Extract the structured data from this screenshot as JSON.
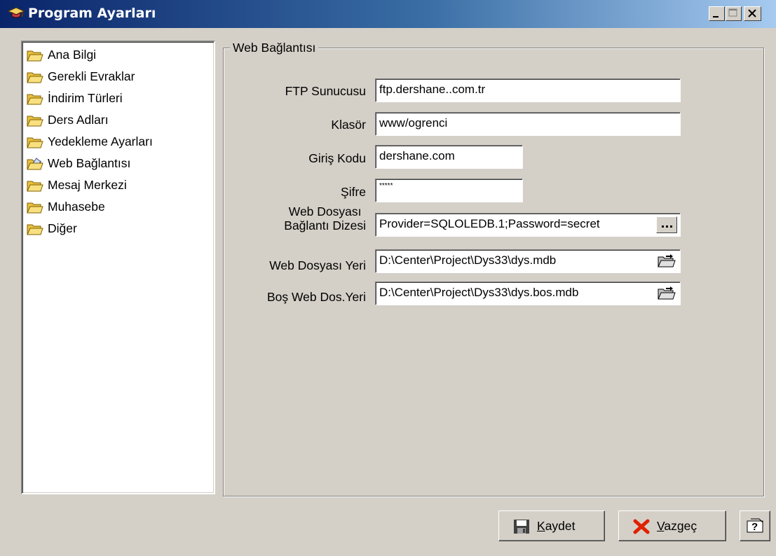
{
  "window": {
    "title": "Program Ayarları",
    "icon": "graduation-cap-icon",
    "controls": [
      "minimize",
      "maximize",
      "close"
    ]
  },
  "tree": {
    "items": [
      {
        "label": "Ana Bilgi",
        "icon": "folder-icon"
      },
      {
        "label": "Gerekli Evraklar",
        "icon": "folder-icon"
      },
      {
        "label": "İndirim Türleri",
        "icon": "folder-icon"
      },
      {
        "label": "Ders Adları",
        "icon": "folder-icon"
      },
      {
        "label": "Yedekleme Ayarları",
        "icon": "folder-icon"
      },
      {
        "label": "Web Bağlantısı",
        "icon": "folder-open-icon",
        "selected": true
      },
      {
        "label": "Mesaj Merkezi",
        "icon": "folder-icon"
      },
      {
        "label": "Muhasebe",
        "icon": "folder-icon"
      },
      {
        "label": "Diğer",
        "icon": "folder-icon"
      }
    ]
  },
  "group": {
    "title": "Web Bağlantısı",
    "fields": {
      "ftp": {
        "label": "FTP Sunucusu",
        "value": "ftp.dershane..com.tr"
      },
      "folder": {
        "label": "Klasör",
        "value": "www/ogrenci"
      },
      "login": {
        "label": "Giriş Kodu",
        "value": "dershane.com"
      },
      "password": {
        "label": "Şifre",
        "value": "*****"
      },
      "connstr": {
        "label_line1": "Web Dosyası",
        "label_line2": "Bağlantı Dizesi",
        "value": "Provider=SQLOLEDB.1;Password=secret"
      },
      "webfile": {
        "label": "Web Dosyası Yeri",
        "value": "D:\\Center\\Project\\Dys33\\dys.mdb"
      },
      "emptyfile": {
        "label": "Boş Web Dos.Yeri",
        "value": "D:\\Center\\Project\\Dys33\\dys.bos.mdb"
      }
    }
  },
  "buttons": {
    "save": {
      "accel": "K",
      "rest": "aydet",
      "icon": "floppy-disk-icon"
    },
    "cancel": {
      "accel": "V",
      "rest": "azgeç",
      "icon": "red-x-icon"
    },
    "help": {
      "icon": "help-icon"
    }
  }
}
